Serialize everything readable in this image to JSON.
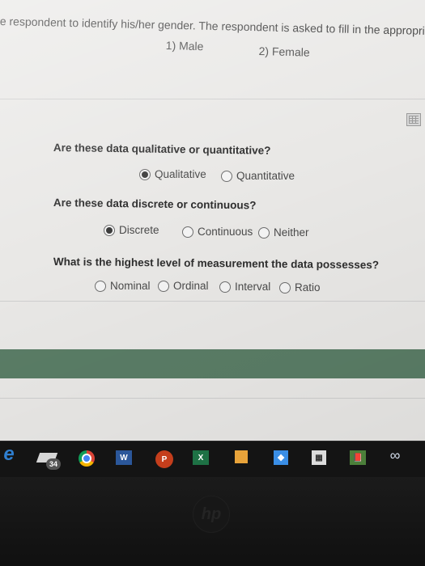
{
  "intro_text": "e respondent to identify his/her gender. The respondent is asked to fill in the appropri",
  "gender_options": [
    "1) Male",
    "2) Female"
  ],
  "questions": [
    {
      "text": "Are these data qualitative or quantitative?",
      "options": [
        {
          "label": "Qualitative",
          "selected": true
        },
        {
          "label": "Quantitative",
          "selected": false
        }
      ]
    },
    {
      "text": "Are these data discrete or continuous?",
      "options": [
        {
          "label": "Discrete",
          "selected": true
        },
        {
          "label": "Continuous",
          "selected": false
        },
        {
          "label": "Neither",
          "selected": false
        }
      ]
    },
    {
      "text": "What is the highest level of measurement the data possesses?",
      "options": [
        {
          "label": "Nominal",
          "selected": false
        },
        {
          "label": "Ordinal",
          "selected": false
        },
        {
          "label": "Interval",
          "selected": false
        },
        {
          "label": "Ratio",
          "selected": false
        }
      ]
    }
  ],
  "colors": {
    "green_bar": "#5a7d66",
    "screen_bg": "#e9e8e6",
    "taskbar_bg": "#141414"
  },
  "taskbar": {
    "icons": [
      "edge-icon",
      "mortarboard-icon",
      "chrome-icon",
      "word-icon",
      "powerpoint-icon",
      "excel-icon",
      "file-explorer-icon",
      "dropbox-icon",
      "store-icon",
      "library-icon",
      "infinity-icon"
    ],
    "edge_glyph": "e",
    "badge_count": "34",
    "word_glyph": "W",
    "powerpoint_glyph": "P",
    "excel_glyph": "X",
    "dropbox_glyph": "❖",
    "store_glyph": "▦",
    "library_glyph": "📕",
    "infinity_glyph": "∞"
  },
  "bezel_logo": "hp"
}
